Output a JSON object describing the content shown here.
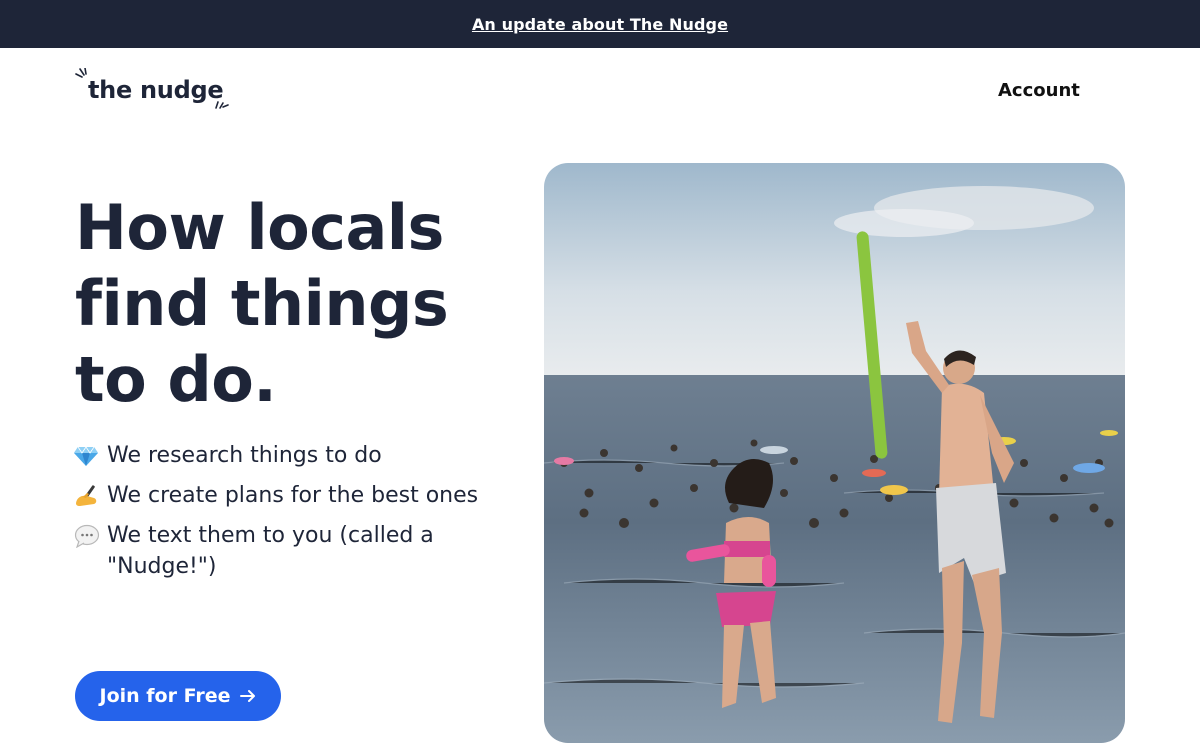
{
  "banner": {
    "link_text": "An update about The Nudge"
  },
  "header": {
    "logo_text": "the nudge",
    "account_label": "Account"
  },
  "hero": {
    "headline": "How locals find things to do.",
    "features": [
      {
        "icon": "gem-icon",
        "text": "We research things to do"
      },
      {
        "icon": "writing-hand-icon",
        "text": "We create plans for the best ones"
      },
      {
        "icon": "speech-bubble-icon",
        "text": "We text them to you (called a \"Nudge!\")"
      }
    ],
    "cta_label": "Join for Free",
    "image_alt": "People swimming in a lake while a man and woman jump in from a pier"
  },
  "colors": {
    "banner_bg": "#1e2538",
    "text_dark": "#1e2538",
    "cta_blue": "#2563eb"
  }
}
